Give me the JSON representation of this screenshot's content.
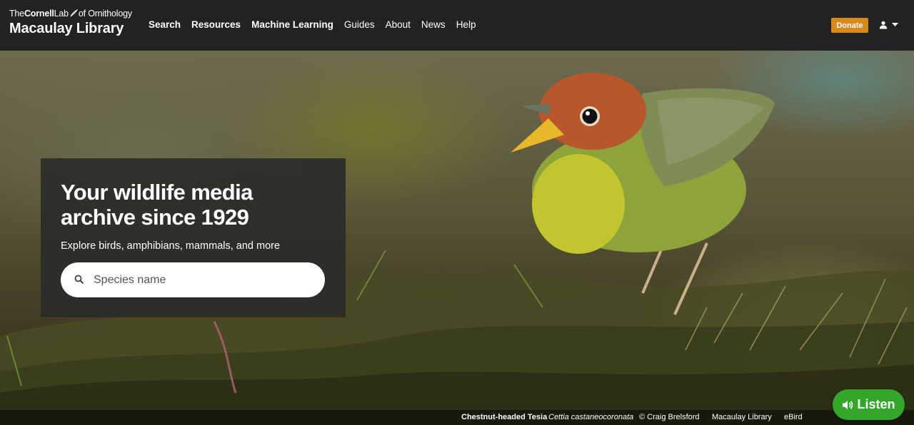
{
  "header": {
    "brand_the": "The",
    "brand_cornell": "Cornell",
    "brand_lab": "Lab",
    "brand_ornithology": "of Ornithology",
    "brand_name": "Macaulay Library",
    "nav": [
      "Search",
      "Resources",
      "Machine Learning",
      "Guides",
      "About",
      "News",
      "Help"
    ],
    "donate_label": "Donate",
    "user_icon": "user-icon",
    "menu_icon": "caret-down-icon"
  },
  "hero": {
    "title_line1": "Your wildlife media",
    "title_line2": "archive since 1929",
    "subtitle": "Explore birds, amphibians, mammals, and more",
    "search_placeholder": "Species name"
  },
  "caption": {
    "common_name": "Chestnut-headed Tesia",
    "scientific_name": "Cettia castaneocoronata",
    "credit": "© Craig Brelsford",
    "library": "Macaulay Library",
    "ebird": "eBird"
  },
  "listen_label": "Listen",
  "colors": {
    "header_bg": "#222222",
    "donate": "#d68a1c",
    "listen": "#34a62a"
  }
}
